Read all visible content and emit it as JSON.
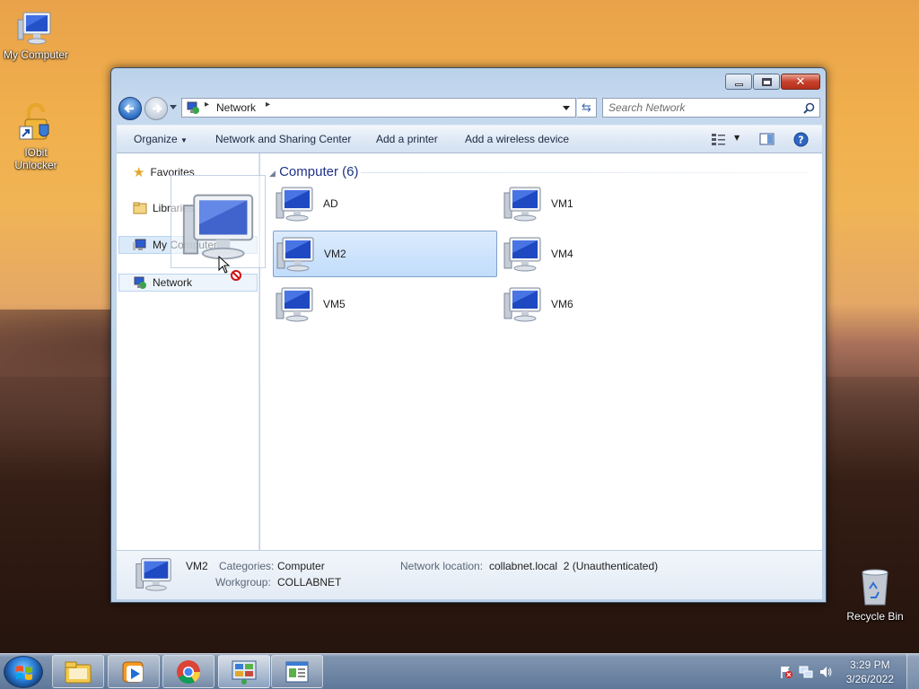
{
  "desktop": {
    "icons": [
      {
        "label": "My Computer"
      },
      {
        "label": "IObit Unlocker"
      },
      {
        "label": "Recycle Bin"
      }
    ]
  },
  "window": {
    "address": {
      "root_icon": "network-icon",
      "segments": [
        "Network"
      ]
    },
    "search": {
      "placeholder": "Search Network"
    },
    "toolbar": {
      "organize": "Organize",
      "network_sharing": "Network and Sharing Center",
      "add_printer": "Add a printer",
      "add_wireless": "Add a wireless device"
    },
    "nav_pane": {
      "items": [
        {
          "label": "Favorites",
          "icon": "star-icon"
        },
        {
          "label": "Libraries",
          "icon": "libraries-icon"
        },
        {
          "label": "My Computer",
          "icon": "computer-icon"
        },
        {
          "label": "Network",
          "icon": "network-icon"
        }
      ]
    },
    "content": {
      "group_title": "Computer (6)",
      "items": [
        {
          "label": "AD",
          "selected": false
        },
        {
          "label": "VM1",
          "selected": false
        },
        {
          "label": "VM2",
          "selected": true
        },
        {
          "label": "VM4",
          "selected": false
        },
        {
          "label": "VM5",
          "selected": false
        },
        {
          "label": "VM6",
          "selected": false
        }
      ]
    },
    "details": {
      "name": "VM2",
      "categories_label": "Categories:",
      "categories_value": "Computer",
      "workgroup_label": "Workgroup:",
      "workgroup_value": "COLLABNET",
      "location_label": "Network location:",
      "location_value": "collabnet.local  2 (Unauthenticated)"
    }
  },
  "taskbar": {
    "clock_time": "3:29 PM",
    "clock_date": "3/26/2022",
    "pinned": [
      "explorer-icon",
      "media-player-icon",
      "chrome-icon",
      "control-panel-icon",
      "document-icon"
    ]
  },
  "colors": {
    "accent": "#1e3287",
    "selection": "#cce4fb"
  }
}
